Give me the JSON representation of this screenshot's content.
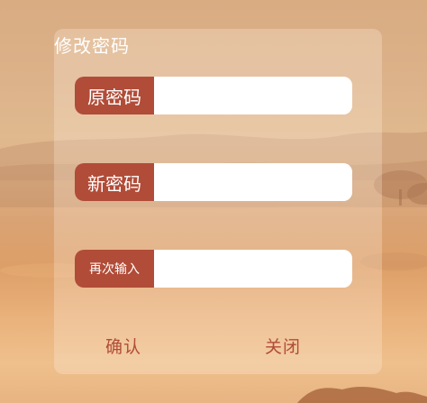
{
  "dialog": {
    "title": "修改密码",
    "fields": [
      {
        "label": "原密码",
        "value": "",
        "placeholder": ""
      },
      {
        "label": "新密码",
        "value": "",
        "placeholder": ""
      },
      {
        "label": "再次输入",
        "value": "",
        "placeholder": ""
      }
    ],
    "confirm_label": "确认",
    "close_label": "关闭"
  },
  "colors": {
    "accent": "#b14c38",
    "panel_overlay": "rgba(255,240,225,0.28)"
  }
}
